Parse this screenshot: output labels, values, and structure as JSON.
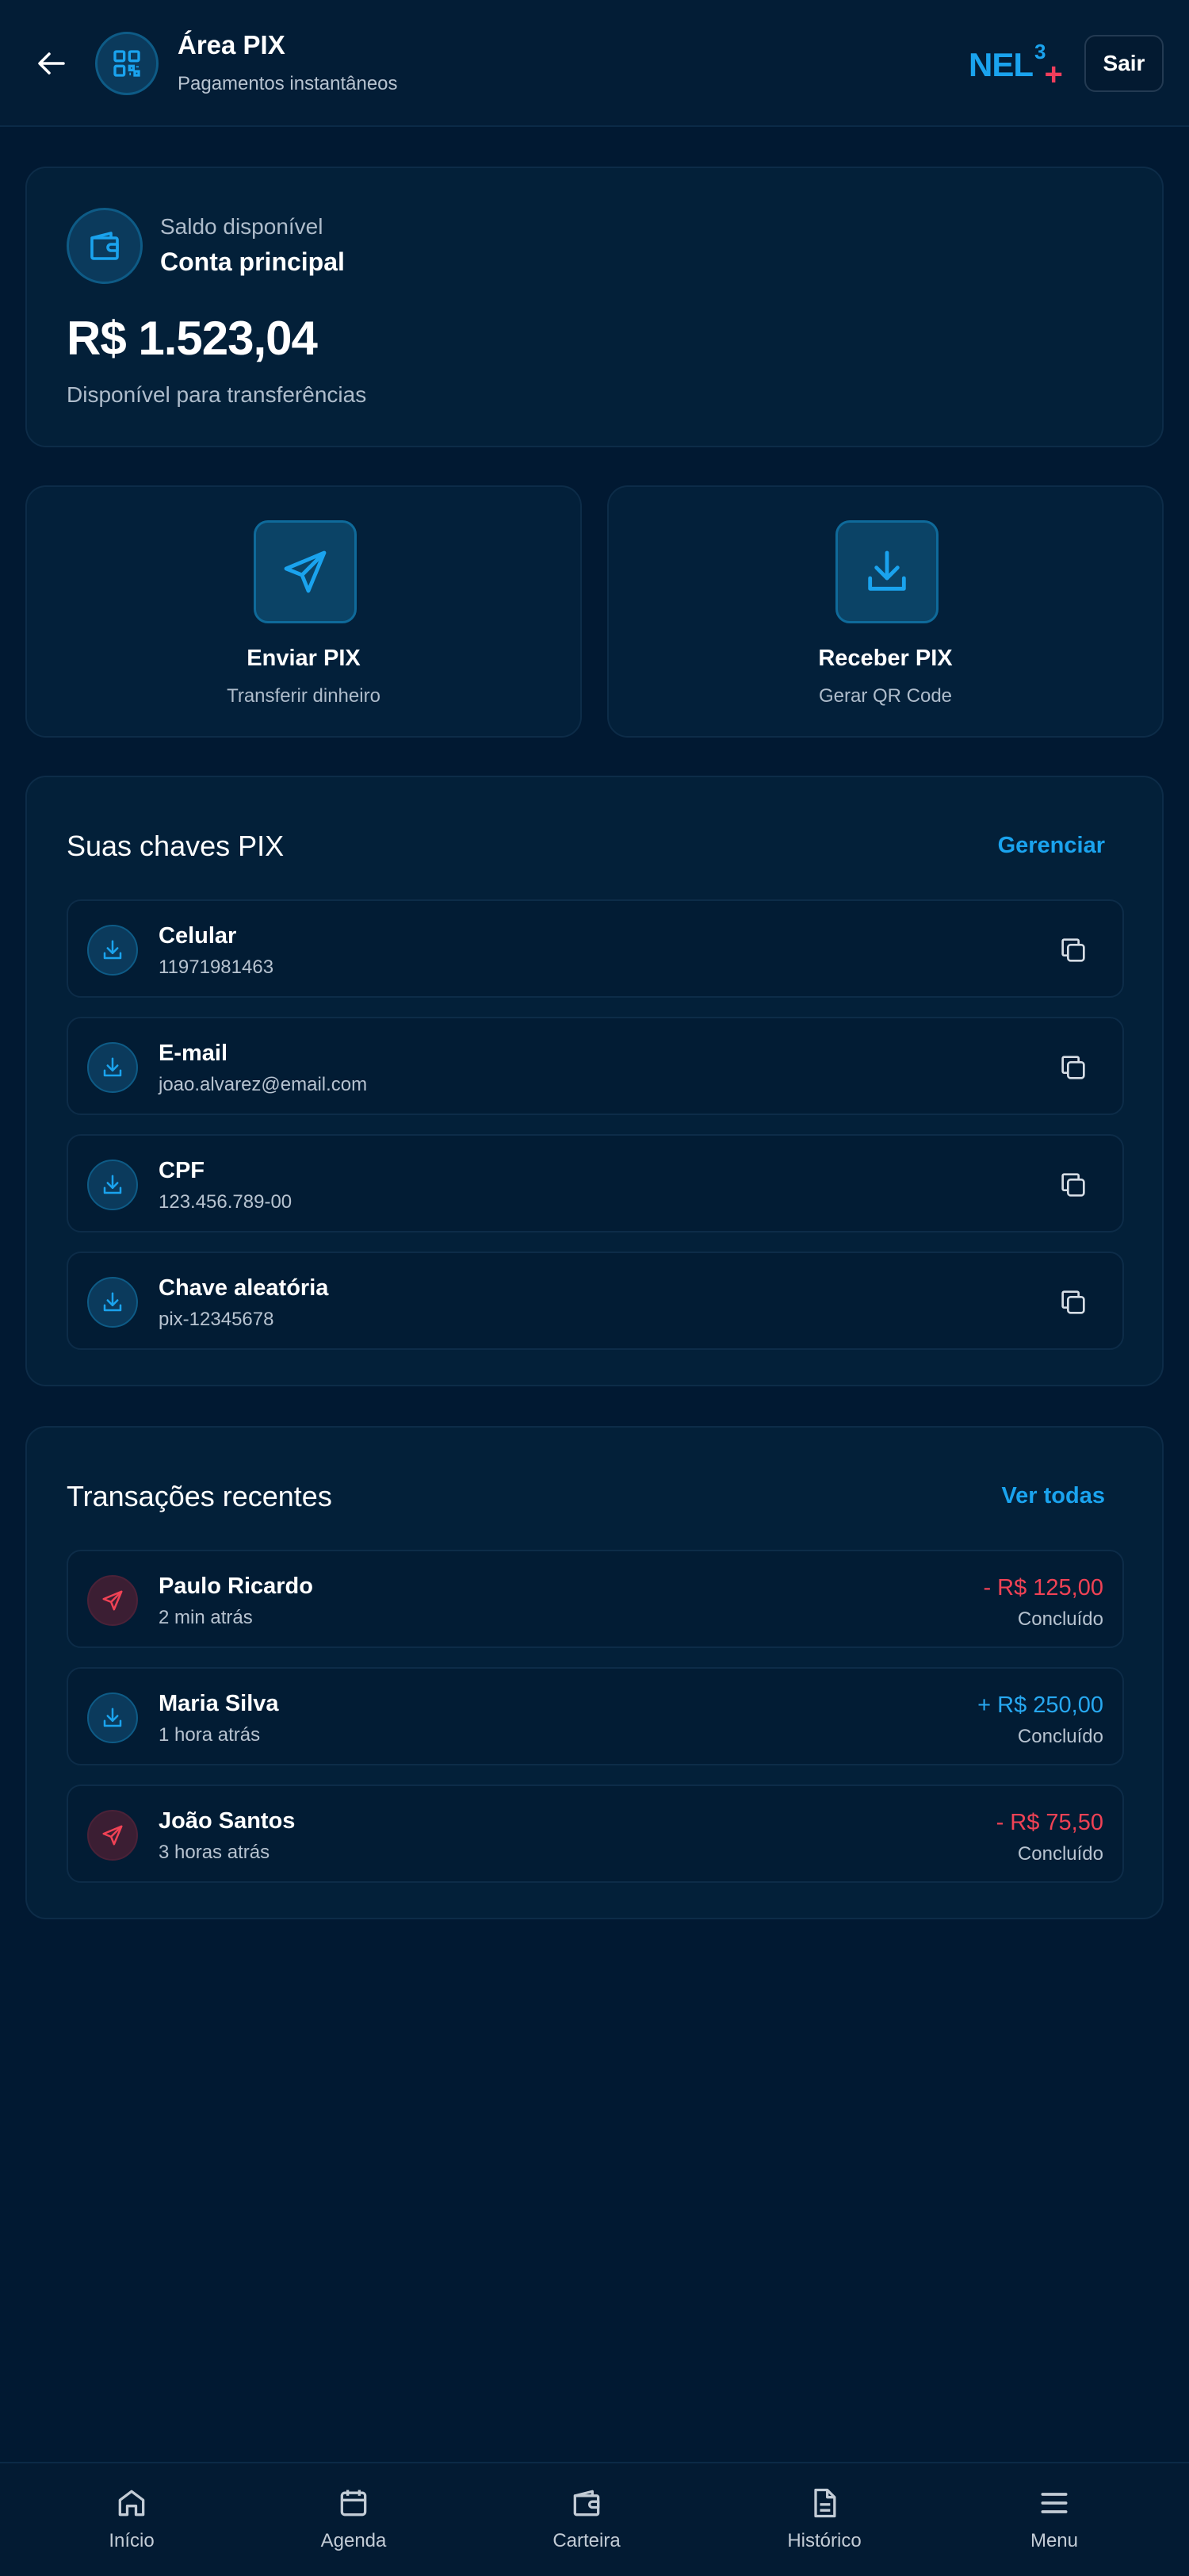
{
  "header": {
    "title": "Área PIX",
    "subtitle": "Pagamentos instantâneos",
    "logo_text": "NEL",
    "logo_sup": "3",
    "logo_plus": "+",
    "logout_label": "Sair"
  },
  "balance": {
    "label": "Saldo disponível",
    "account": "Conta principal",
    "amount": "R$ 1.523,04",
    "note": "Disponível para transferências"
  },
  "actions": [
    {
      "title": "Enviar PIX",
      "subtitle": "Transferir dinheiro",
      "icon": "send-icon"
    },
    {
      "title": "Receber PIX",
      "subtitle": "Gerar QR Code",
      "icon": "download-icon"
    }
  ],
  "keys": {
    "title": "Suas chaves PIX",
    "manage_label": "Gerenciar",
    "items": [
      {
        "type": "Celular",
        "value": "11971981463"
      },
      {
        "type": "E-mail",
        "value": "joao.alvarez@email.com"
      },
      {
        "type": "CPF",
        "value": "123.456.789-00"
      },
      {
        "type": "Chave aleatória",
        "value": "pix-12345678"
      }
    ]
  },
  "transactions": {
    "title": "Transações recentes",
    "view_all_label": "Ver todas",
    "items": [
      {
        "name": "Paulo Ricardo",
        "time": "2 min atrás",
        "amount": "- R$ 125,00",
        "status": "Concluído",
        "direction": "out"
      },
      {
        "name": "Maria Silva",
        "time": "1 hora atrás",
        "amount": "+ R$ 250,00",
        "status": "Concluído",
        "direction": "in"
      },
      {
        "name": "João Santos",
        "time": "3 horas atrás",
        "amount": "- R$ 75,50",
        "status": "Concluído",
        "direction": "out"
      }
    ]
  },
  "nav": {
    "items": [
      {
        "label": "Início",
        "icon": "home-icon"
      },
      {
        "label": "Agenda",
        "icon": "calendar-icon"
      },
      {
        "label": "Carteira",
        "icon": "wallet-icon"
      },
      {
        "label": "Histórico",
        "icon": "document-icon"
      },
      {
        "label": "Menu",
        "icon": "menu-icon"
      }
    ]
  },
  "colors": {
    "background": "#011932",
    "accent": "#1aa3ee",
    "negative": "#f04255",
    "positive": "#27a8f0",
    "brand_plus": "#ef3e5c"
  }
}
